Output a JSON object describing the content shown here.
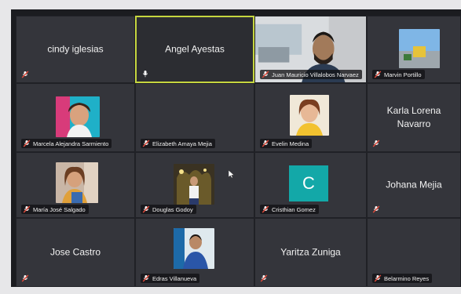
{
  "participants": [
    {
      "name": "cindy iglesias",
      "mode": "name",
      "muted": true
    },
    {
      "name": "Angel Ayestas",
      "mode": "name",
      "active_speaker": true
    },
    {
      "name": "Juan Mauricio Villalobos Narvaez",
      "mode": "video",
      "muted": true
    },
    {
      "name": "Marvin Portillo",
      "mode": "video",
      "muted": true
    },
    {
      "name": "Marcela Alejandra Sarmiento",
      "mode": "photo",
      "muted": true
    },
    {
      "name": "Elizabeth Amaya Mejia",
      "mode": "label-only",
      "muted": true
    },
    {
      "name": "Evelin Medina",
      "mode": "photo",
      "muted": true
    },
    {
      "name": "Karla Lorena Navarro",
      "mode": "name",
      "muted": true
    },
    {
      "name": "María José Salgado",
      "mode": "photo",
      "muted": true
    },
    {
      "name": "Douglas Godoy",
      "mode": "photo",
      "muted": true
    },
    {
      "name": "Cristhian Gomez",
      "mode": "avatar",
      "avatar_letter": "C",
      "avatar_color": "#13a8a8",
      "muted": true
    },
    {
      "name": "Johana Mejia",
      "mode": "name",
      "muted": true
    },
    {
      "name": "Jose Castro",
      "mode": "name",
      "muted": true
    },
    {
      "name": "Edras Villanueva",
      "mode": "photo",
      "muted": true
    },
    {
      "name": "Yaritza Zuniga",
      "mode": "name",
      "muted": true
    },
    {
      "name": "Belarmino Reyes",
      "mode": "label-only",
      "muted": true
    }
  ],
  "colors": {
    "active_border": "#c6d63f",
    "tile_bg": "#34353b",
    "muted_icon": "#e24b3b"
  },
  "icons": {
    "muted": "mic-off-icon",
    "unmuted": "mic-icon",
    "cursor": "pointer-cursor-icon"
  }
}
